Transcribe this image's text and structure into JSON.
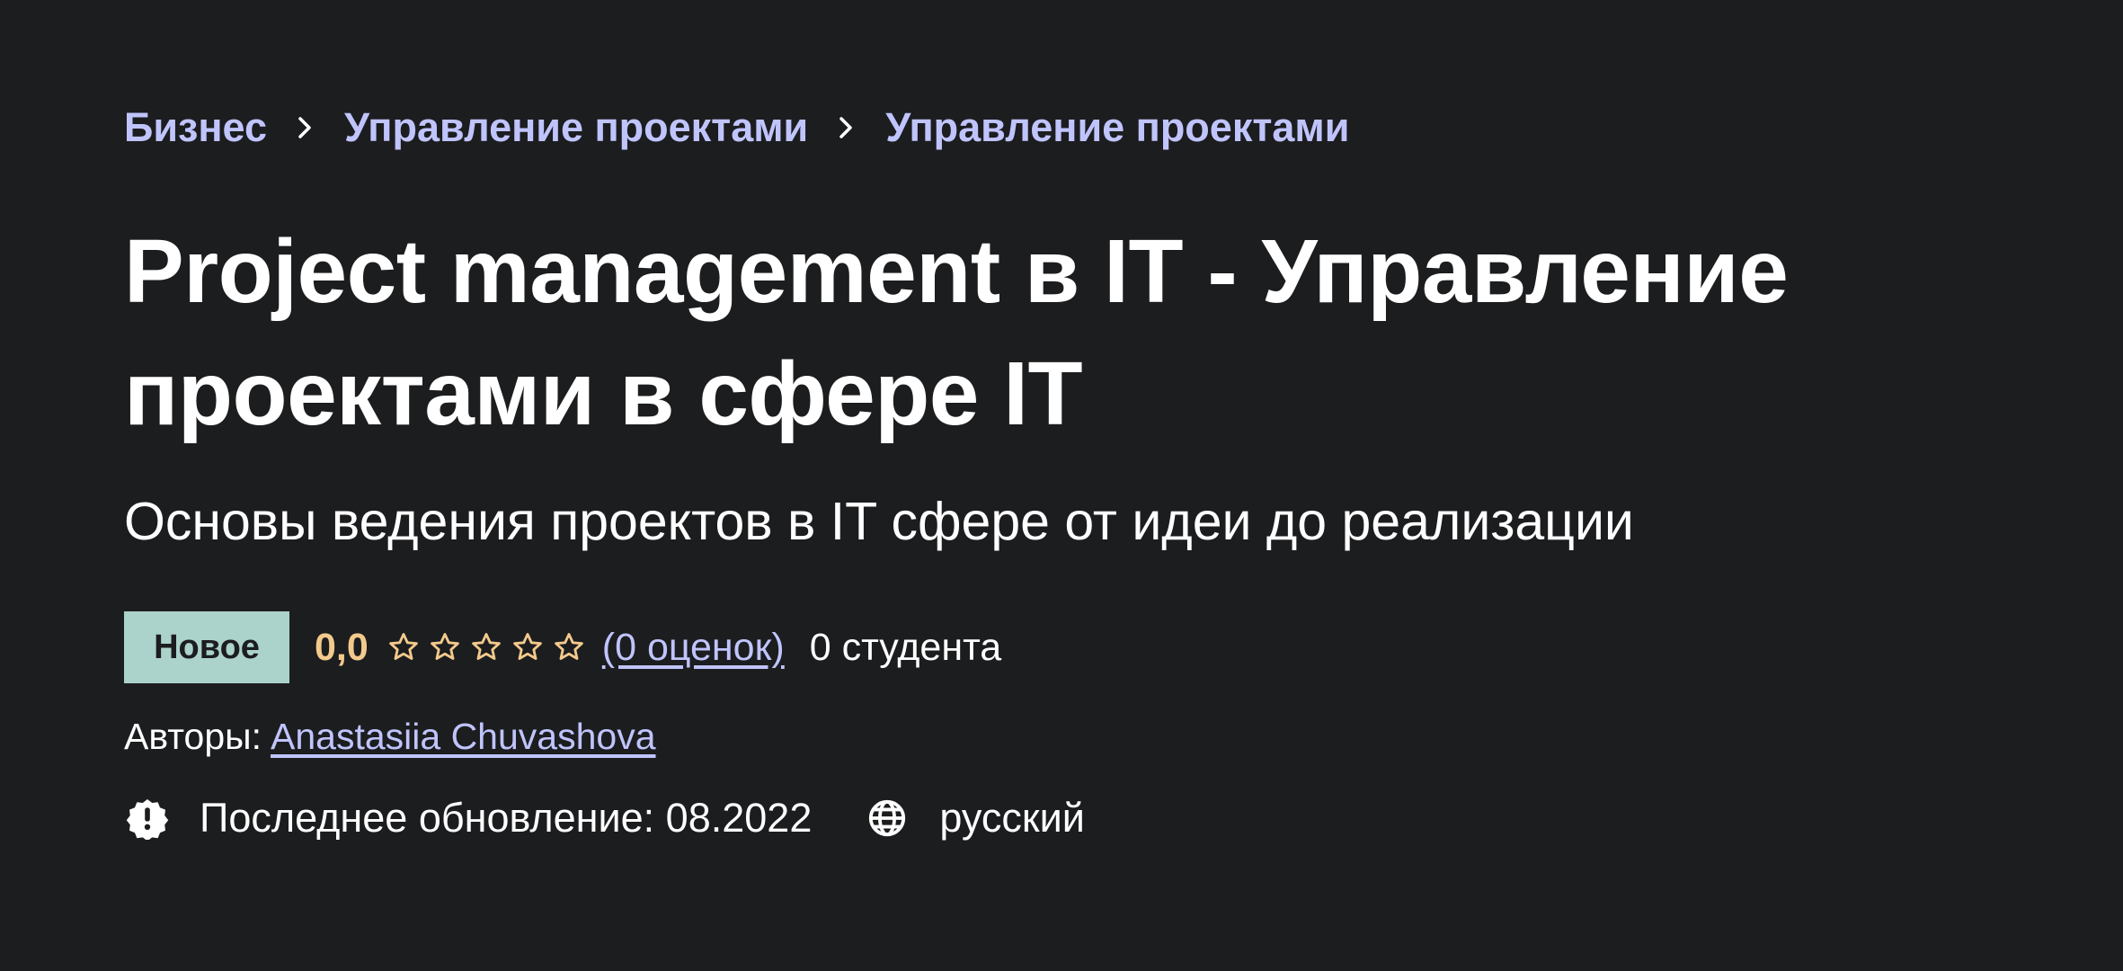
{
  "breadcrumb": {
    "items": [
      {
        "label": "Бизнес"
      },
      {
        "label": "Управление проектами"
      },
      {
        "label": "Управление проектами"
      }
    ]
  },
  "course": {
    "title": "Project management в IT - Управление проектами в сфере IT",
    "subtitle": "Основы ведения проектов в IT сфере от идеи до реализации"
  },
  "rating": {
    "badge": "Новое",
    "score": "0,0",
    "stars_total": 5,
    "stars_filled": 0,
    "reviews": "(0 оценок)",
    "students": "0 студента"
  },
  "authors": {
    "label": "Авторы:",
    "name": "Anastasiia Chuvashova"
  },
  "meta": {
    "updated": "Последнее обновление: 08.2022",
    "language": "русский",
    "updated_icon": "alert-badge-icon",
    "language_icon": "globe-icon"
  },
  "colors": {
    "background": "#1c1d1f",
    "link": "#c0c4fc",
    "rating": "#f3ca8c",
    "badge_bg": "#acd2cc",
    "text": "#ffffff"
  }
}
